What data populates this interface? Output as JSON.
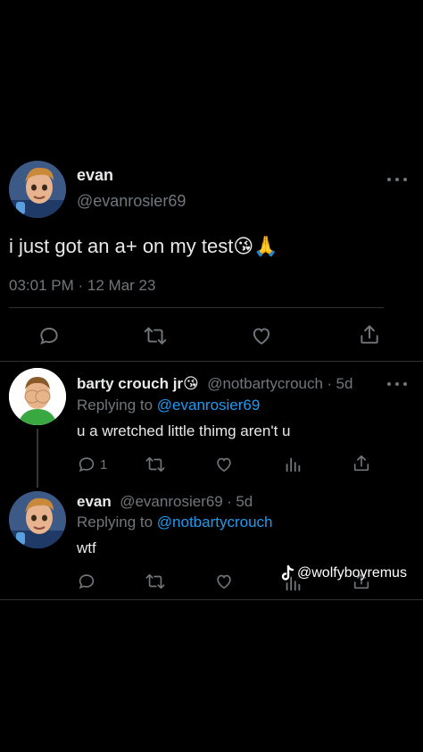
{
  "main_tweet": {
    "display_name": "evan",
    "handle": "@evanrosier69",
    "text": "i just got an a+ on my test😘🙏",
    "time": "03:01 PM",
    "separator": "·",
    "date": "12 Mar 23",
    "avatar_icon": "cartoon-boy-avatar"
  },
  "replies": [
    {
      "display_name": "barty crouch jr😘",
      "handle": "@notbartycrouch",
      "separator": "·",
      "age": "5d",
      "replying_prefix": "Replying to",
      "replying_to": "@evanrosier69",
      "text": "u a wretched little thimg aren't u",
      "reply_count": "1",
      "avatar_icon": "cartoon-facepalm-avatar"
    },
    {
      "display_name": "evan",
      "handle": "@evanrosier69",
      "separator": "·",
      "age": "5d",
      "replying_prefix": "Replying to",
      "replying_to": "@notbartycrouch",
      "text": "wtf",
      "avatar_icon": "cartoon-boy-avatar"
    }
  ],
  "watermark": {
    "icon": "tiktok-icon",
    "text": "@wolfyboyremus"
  },
  "colors": {
    "background": "#000000",
    "text": "#e7e9ea",
    "muted": "#71767b",
    "link": "#1d9bf0",
    "divider": "#2f3336"
  }
}
